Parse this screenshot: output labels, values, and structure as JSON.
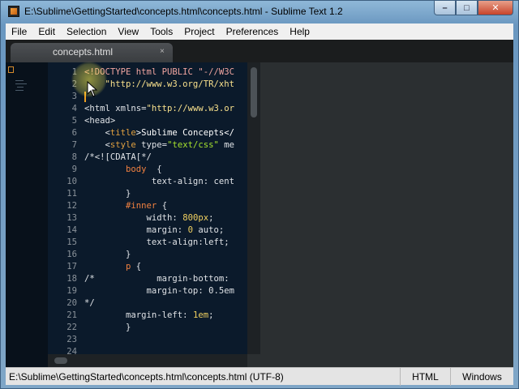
{
  "window": {
    "title": "E:\\Sublime\\GettingStarted\\concepts.html\\concepts.html - Sublime Text 1.2",
    "icon": "sublime-icon",
    "controls": {
      "minimize": "–",
      "maximize": "□",
      "close": "✕"
    }
  },
  "menu": [
    "File",
    "Edit",
    "Selection",
    "View",
    "Tools",
    "Project",
    "Preferences",
    "Help"
  ],
  "tab": {
    "label": "concepts.html",
    "close_glyph": "×"
  },
  "editor": {
    "line_numbers": [
      "1",
      "2",
      "3",
      "4",
      "5",
      "6",
      "7",
      "8",
      "9",
      "10",
      "11",
      "12",
      "13",
      "14",
      "15",
      "16",
      "17",
      "18",
      "19",
      "20",
      "21",
      "22",
      "23",
      "24"
    ],
    "code_lines": [
      [
        {
          "t": "<!DOCTYPE html PUBLIC \"-//W3C",
          "c": "#f0a5a0"
        }
      ],
      [
        {
          "t": "    \"http://www.w3.org/TR/xht",
          "c": "#f8e08c"
        }
      ],
      [],
      [
        {
          "t": "<html xmlns=",
          "c": "#dfe2e6"
        },
        {
          "t": "\"http://www.w3.or",
          "c": "#f8e08c"
        }
      ],
      [
        {
          "t": "<head>",
          "c": "#dfe2e6"
        }
      ],
      [
        {
          "t": "    <",
          "c": "#dfe2e6"
        },
        {
          "t": "title",
          "c": "#e0a040"
        },
        {
          "t": ">Sublime Concepts</",
          "c": "#ffffff"
        }
      ],
      [
        {
          "t": "    <",
          "c": "#dfe2e6"
        },
        {
          "t": "style ",
          "c": "#e0a040"
        },
        {
          "t": "type=",
          "c": "#dfe2e6"
        },
        {
          "t": "\"text/css\"",
          "c": "#a6e22e"
        },
        {
          "t": " me",
          "c": "#dfe2e6"
        }
      ],
      [
        {
          "t": "/*<![CDATA[*/",
          "c": "#dfe2e6"
        }
      ],
      [
        {
          "t": "        ",
          "c": "#dfe2e6"
        },
        {
          "t": "body",
          "c": "#f08040"
        },
        {
          "t": "  {",
          "c": "#dfe2e6"
        }
      ],
      [
        {
          "t": "             text-align: cent",
          "c": "#dfe2e6"
        }
      ],
      [
        {
          "t": "        }",
          "c": "#dfe2e6"
        }
      ],
      [
        {
          "t": "        ",
          "c": "#dfe2e6"
        },
        {
          "t": "#inner",
          "c": "#f08040"
        },
        {
          "t": " {",
          "c": "#dfe2e6"
        }
      ],
      [
        {
          "t": "            width: ",
          "c": "#dfe2e6"
        },
        {
          "t": "800px",
          "c": "#f0d060"
        },
        {
          "t": ";",
          "c": "#dfe2e6"
        }
      ],
      [
        {
          "t": "            margin: ",
          "c": "#dfe2e6"
        },
        {
          "t": "0",
          "c": "#f0d060"
        },
        {
          "t": " auto;",
          "c": "#dfe2e6"
        }
      ],
      [
        {
          "t": "            text-align:left;",
          "c": "#dfe2e6"
        }
      ],
      [
        {
          "t": "        }",
          "c": "#dfe2e6"
        }
      ],
      [
        {
          "t": "        ",
          "c": "#dfe2e6"
        },
        {
          "t": "p",
          "c": "#f08040"
        },
        {
          "t": " {",
          "c": "#dfe2e6"
        }
      ],
      [
        {
          "t": "/*            margin-bottom:",
          "c": "#dfe2e6"
        }
      ],
      [
        {
          "t": "            margin-top: 0.5em",
          "c": "#dfe2e6"
        }
      ],
      [
        {
          "t": "*/",
          "c": "#dfe2e6"
        }
      ],
      [
        {
          "t": "        margin-left: ",
          "c": "#dfe2e6"
        },
        {
          "t": "1em",
          "c": "#f0d060"
        },
        {
          "t": ";",
          "c": "#dfe2e6"
        }
      ],
      [
        {
          "t": "        }",
          "c": "#dfe2e6"
        }
      ],
      [],
      []
    ],
    "caret_line": 3
  },
  "status": {
    "path": "E:\\Sublime\\GettingStarted\\concepts.html\\concepts.html (UTF-8)",
    "syntax": "HTML",
    "line_endings": "Windows"
  }
}
